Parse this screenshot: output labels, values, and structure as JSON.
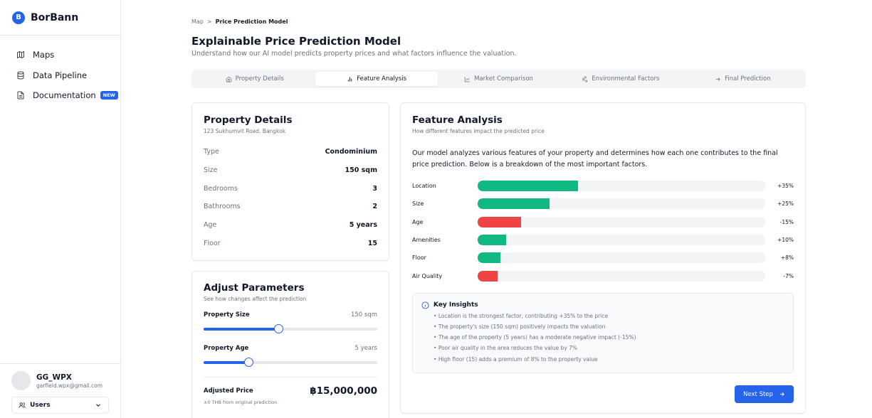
{
  "brand": {
    "logo_letter": "B",
    "name": "BorBann",
    "accent": "#2563eb"
  },
  "sidebar": {
    "items": [
      {
        "label": "Maps",
        "icon": "map-icon"
      },
      {
        "label": "Data Pipeline",
        "icon": "database-icon"
      },
      {
        "label": "Documentation",
        "icon": "document-icon",
        "badge": "NEW"
      }
    ]
  },
  "user": {
    "name": "GG_WPX",
    "email": "garfield.wpx@gmail.com",
    "selector_label": "Users"
  },
  "breadcrumb": {
    "parent": "Map",
    "separator": ">",
    "current": "Price Prediction Model"
  },
  "page": {
    "title": "Explainable Price Prediction Model",
    "subtitle": "Understand how our AI model predicts property prices and what factors influence the valuation."
  },
  "tabs": [
    {
      "label": "Property Details",
      "icon": "home-icon"
    },
    {
      "label": "Feature Analysis",
      "icon": "bar-chart-icon",
      "active": true
    },
    {
      "label": "Market Comparison",
      "icon": "line-chart-icon"
    },
    {
      "label": "Environmental Factors",
      "icon": "wind-icon"
    },
    {
      "label": "Final Prediction",
      "icon": "arrow-right-icon"
    }
  ],
  "property_details": {
    "title": "Property Details",
    "address": "123 Sukhumvit Road, Bangkok",
    "rows": [
      {
        "key": "Type",
        "value": "Condominium"
      },
      {
        "key": "Size",
        "value": "150 sqm"
      },
      {
        "key": "Bedrooms",
        "value": "3"
      },
      {
        "key": "Bathrooms",
        "value": "2"
      },
      {
        "key": "Age",
        "value": "5 years"
      },
      {
        "key": "Floor",
        "value": "15"
      }
    ]
  },
  "adjust": {
    "title": "Adjust Parameters",
    "subtitle": "See how changes affect the prediction",
    "size": {
      "label": "Property Size",
      "value": "150 sqm",
      "fraction": 0.43
    },
    "age": {
      "label": "Property Age",
      "value": "5 years",
      "fraction": 0.26
    },
    "price_label": "Adjusted Price",
    "price": "฿15,000,000",
    "note": "±0 THB from original prediction"
  },
  "feature_analysis": {
    "title": "Feature Analysis",
    "subtitle": "How different features impact the predicted price",
    "description": "Our model analyzes various features of your property and determines how each one contributes to the final price prediction. Below is a breakdown of the most important factors.",
    "positive_color": "#10b981",
    "negative_color": "#ef4444",
    "features": [
      {
        "name": "Location",
        "value": 35,
        "label": "+35%"
      },
      {
        "name": "Size",
        "value": 25,
        "label": "+25%"
      },
      {
        "name": "Age",
        "value": -15,
        "label": "-15%"
      },
      {
        "name": "Amenities",
        "value": 10,
        "label": "+10%"
      },
      {
        "name": "Floor",
        "value": 8,
        "label": "+8%"
      },
      {
        "name": "Air Quality",
        "value": -7,
        "label": "-7%"
      }
    ],
    "insights_title": "Key Insights",
    "insights": [
      "Location is the strongest factor, contributing +35% to the price",
      "The property's size (150 sqm) positively impacts the valuation",
      "The age of the property (5 years) has a moderate negative impact (-15%)",
      "Poor air quality in the area reduces the value by 7%",
      "High floor (15) adds a premium of 8% to the property value"
    ],
    "next_label": "Next Step"
  }
}
